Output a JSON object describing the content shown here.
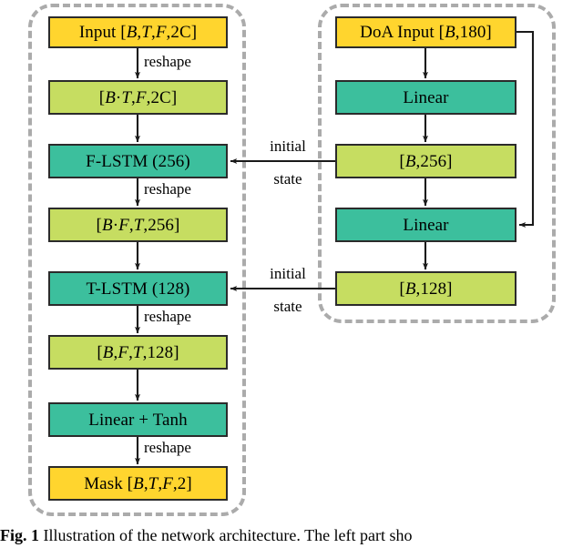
{
  "figure": {
    "caption_label": "Fig. 1",
    "caption_text": "Illustration of the network architecture. The left part sho"
  },
  "panels": [
    {
      "name": "separation-network-panel",
      "style": "dashed-rounded"
    },
    {
      "name": "doa-embedding-panel",
      "style": "dashed-rounded"
    }
  ],
  "left_column": {
    "nodes": [
      {
        "id": "input",
        "label": "Input [B,T,F,2C]",
        "color": "#FFD52E",
        "kind": "tensor"
      },
      {
        "id": "bt_f_2c",
        "label": "[B·T,F,2C]",
        "color": "#C6DD61",
        "kind": "shape"
      },
      {
        "id": "f_lstm",
        "label": "F-LSTM (256)",
        "color": "#3CBF9D",
        "kind": "layer"
      },
      {
        "id": "bf_t_256",
        "label": "[B·F,T,256]",
        "color": "#C6DD61",
        "kind": "shape"
      },
      {
        "id": "t_lstm",
        "label": "T-LSTM (128)",
        "color": "#3CBF9D",
        "kind": "layer"
      },
      {
        "id": "b_f_t_128",
        "label": "[B,F,T,128]",
        "color": "#C6DD61",
        "kind": "shape"
      },
      {
        "id": "linear_tanh",
        "label": "Linear + Tanh",
        "color": "#3CBF9D",
        "kind": "layer"
      },
      {
        "id": "mask",
        "label": "Mask [B,T,F,2]",
        "color": "#FFD52E",
        "kind": "tensor"
      }
    ],
    "edge_labels": [
      {
        "id": "reshape1",
        "text": "reshape"
      },
      {
        "id": "reshape2",
        "text": "reshape"
      },
      {
        "id": "reshape3",
        "text": "reshape"
      },
      {
        "id": "reshape4",
        "text": "reshape"
      }
    ]
  },
  "right_column": {
    "nodes": [
      {
        "id": "doa_input",
        "label": "DoA Input [B,180]",
        "color": "#FFD52E",
        "kind": "tensor"
      },
      {
        "id": "linear1",
        "label": "Linear",
        "color": "#3CBF9D",
        "kind": "layer"
      },
      {
        "id": "b_256",
        "label": "[B,256]",
        "color": "#C6DD61",
        "kind": "shape"
      },
      {
        "id": "linear2",
        "label": "Linear",
        "color": "#3CBF9D",
        "kind": "layer"
      },
      {
        "id": "b_128",
        "label": "[B,128]",
        "color": "#C6DD61",
        "kind": "shape"
      }
    ]
  },
  "cross_edges": [
    {
      "id": "init_state_f",
      "line1": "initial",
      "line2": "state",
      "from": "b_256",
      "to": "f_lstm"
    },
    {
      "id": "init_state_t",
      "line1": "initial",
      "line2": "state",
      "from": "b_128",
      "to": "t_lstm"
    }
  ],
  "colors": {
    "yellow": "#FFD52E",
    "teal": "#3CBF9D",
    "light_green": "#C6DD61",
    "box_border": "#2B2B2B",
    "panel_dash": "#ABABAB",
    "wire": "#1A1A1A"
  }
}
